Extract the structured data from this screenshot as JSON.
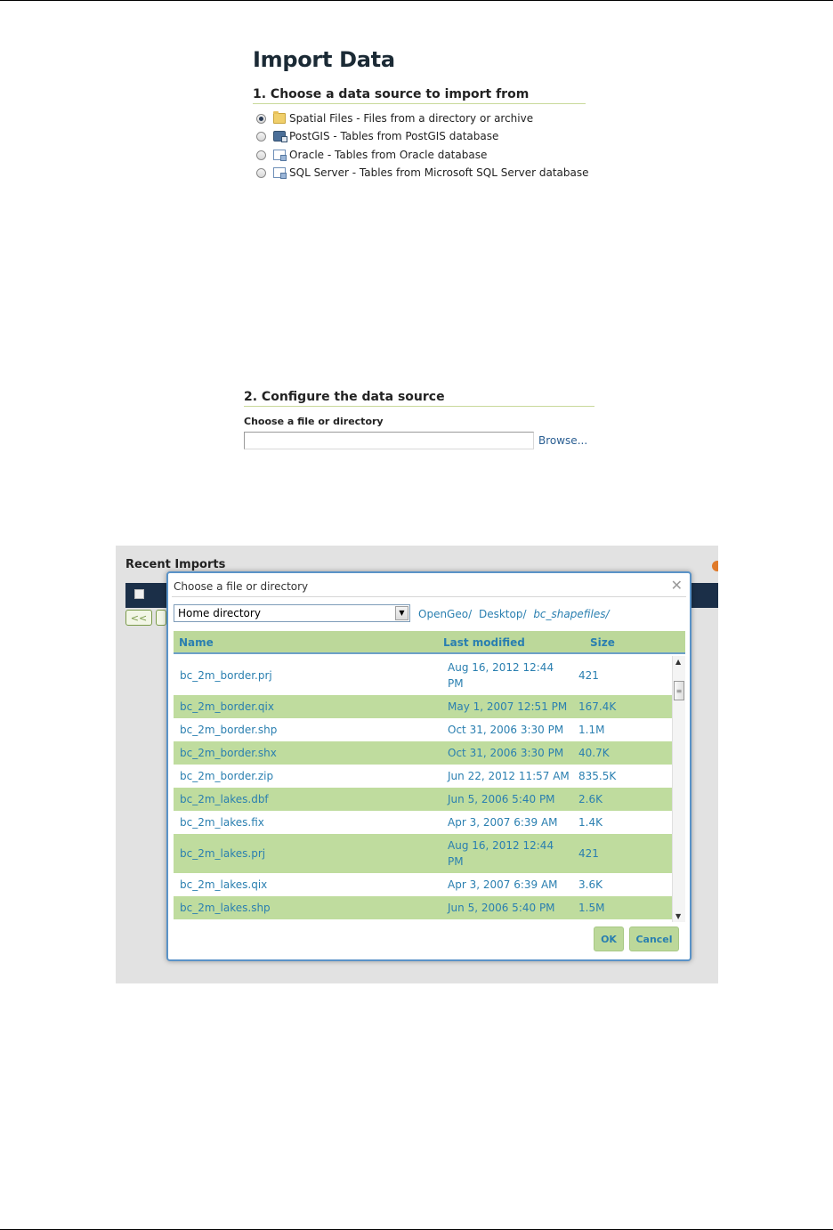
{
  "page": {
    "title": "Import Data",
    "section1": {
      "title": "1. Choose a data source to import from",
      "options": [
        {
          "label": "Spatial Files - Files from a directory or archive",
          "icon": "folder-icon",
          "selected": true
        },
        {
          "label": "PostGIS - Tables from PostGIS database",
          "icon": "postgis-icon",
          "selected": false
        },
        {
          "label": "Oracle - Tables from Oracle database",
          "icon": "database-icon",
          "selected": false
        },
        {
          "label": "SQL Server - Tables from Microsoft SQL Server database",
          "icon": "database-icon",
          "selected": false
        }
      ]
    },
    "section2": {
      "title": "2. Configure the data source",
      "field_label": "Choose a file or directory",
      "field_value": "",
      "browse_label": "Browse..."
    }
  },
  "background": {
    "recent_imports_title": "Recent Imports",
    "pager_first": "<<"
  },
  "dialog": {
    "title": "Choose a file or directory",
    "close_icon": "close-icon",
    "location_select": "Home directory",
    "breadcrumbs": [
      "OpenGeo/",
      "Desktop/",
      "bc_shapefiles/"
    ],
    "columns": {
      "name": "Name",
      "modified": "Last modified",
      "size": "Size"
    },
    "files": [
      {
        "name": "bc_2m_border.prj",
        "modified": "Aug 16, 2012 12:44 PM",
        "size": "421"
      },
      {
        "name": "bc_2m_border.qix",
        "modified": "May 1, 2007 12:51 PM",
        "size": "167.4K"
      },
      {
        "name": "bc_2m_border.shp",
        "modified": "Oct 31, 2006 3:30 PM",
        "size": "1.1M"
      },
      {
        "name": "bc_2m_border.shx",
        "modified": "Oct 31, 2006 3:30 PM",
        "size": "40.7K"
      },
      {
        "name": "bc_2m_border.zip",
        "modified": "Jun 22, 2012 11:57 AM",
        "size": "835.5K"
      },
      {
        "name": "bc_2m_lakes.dbf",
        "modified": "Jun 5, 2006 5:40 PM",
        "size": "2.6K"
      },
      {
        "name": "bc_2m_lakes.fix",
        "modified": "Apr 3, 2007 6:39 AM",
        "size": "1.4K"
      },
      {
        "name": "bc_2m_lakes.prj",
        "modified": "Aug 16, 2012 12:44 PM",
        "size": "421"
      },
      {
        "name": "bc_2m_lakes.qix",
        "modified": "Apr 3, 2007 6:39 AM",
        "size": "3.6K"
      },
      {
        "name": "bc_2m_lakes.shp",
        "modified": "Jun 5, 2006 5:40 PM",
        "size": "1.5M"
      }
    ],
    "ok_label": "OK",
    "cancel_label": "Cancel",
    "colors": {
      "header_bg": "#bcd89a",
      "row_alt_bg": "#bfdc9e",
      "link": "#2a7fb0",
      "border": "#5a93c8"
    }
  }
}
